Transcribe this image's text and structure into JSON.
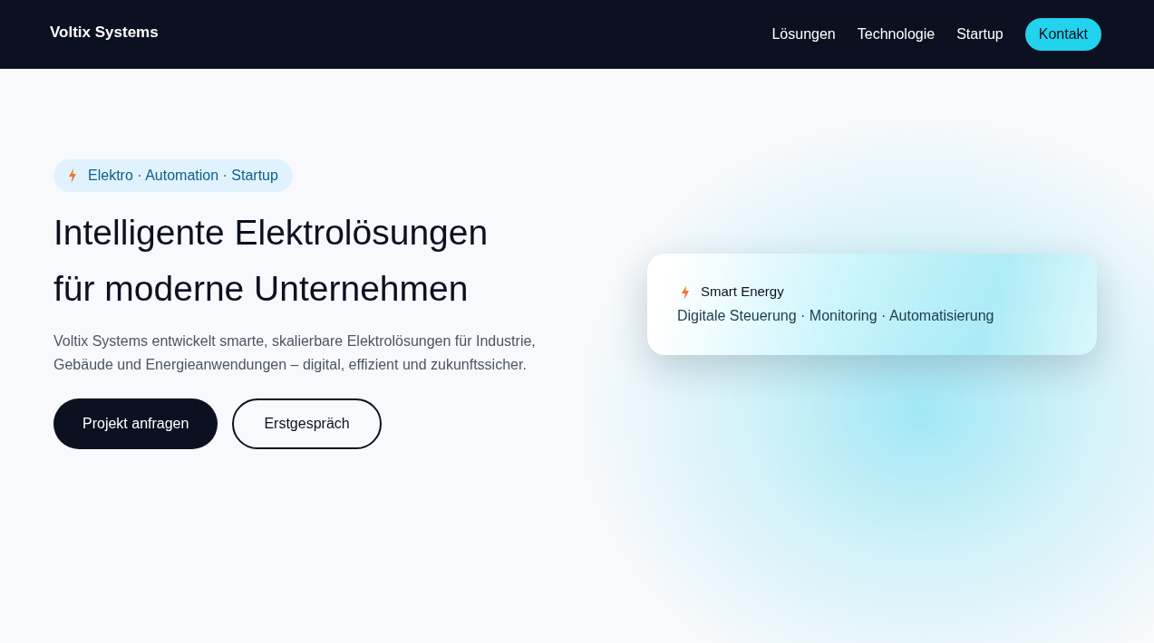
{
  "header": {
    "logo": "Voltix Systems",
    "nav": [
      {
        "label": "Lösungen",
        "kind": "link"
      },
      {
        "label": "Technologie",
        "kind": "link"
      },
      {
        "label": "Startup",
        "kind": "link"
      },
      {
        "label": "Kontakt",
        "kind": "button"
      }
    ]
  },
  "hero": {
    "badge": "Elektro · Automation · Startup",
    "title_lines": [
      "Intelligente Elektrolösungen",
      "für moderne Unternehmen"
    ],
    "description": "Voltix Systems entwickelt smarte, skalierbare Elektrolösungen für Industrie, Gebäude und Energieanwendungen – digital, effizient und zukunftssicher.",
    "buttons": [
      {
        "label": "Projekt anfragen",
        "kind": "primary"
      },
      {
        "label": "Erstgespräch",
        "kind": "outline"
      }
    ]
  },
  "card": {
    "title": "Smart Energy",
    "subtitle": "Digitale Steuerung · Monitoring · Automatisierung"
  }
}
